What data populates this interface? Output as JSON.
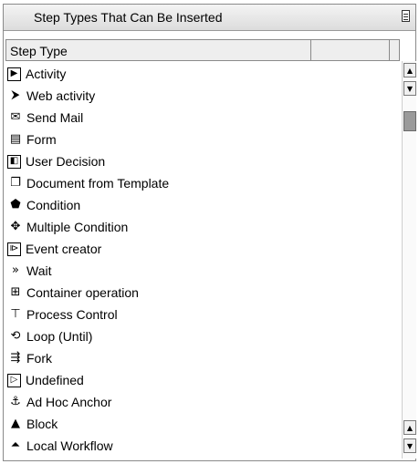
{
  "panel": {
    "title": "Step Types That Can Be Inserted"
  },
  "table": {
    "column_header": "Step Type",
    "rows": [
      {
        "label": "Activity",
        "icon": "activity-icon",
        "glyph": "▶"
      },
      {
        "label": "Web activity",
        "icon": "web-activity-icon",
        "glyph": "⮞"
      },
      {
        "label": "Send Mail",
        "icon": "send-mail-icon",
        "glyph": "✉"
      },
      {
        "label": "Form",
        "icon": "form-icon",
        "glyph": "▤"
      },
      {
        "label": "User Decision",
        "icon": "user-decision-icon",
        "glyph": "◧"
      },
      {
        "label": "Document from Template",
        "icon": "document-template-icon",
        "glyph": "❐"
      },
      {
        "label": "Condition",
        "icon": "condition-icon",
        "glyph": "⬟"
      },
      {
        "label": "Multiple Condition",
        "icon": "multiple-condition-icon",
        "glyph": "✥"
      },
      {
        "label": "Event creator",
        "icon": "event-creator-icon",
        "glyph": "⧐"
      },
      {
        "label": "Wait",
        "icon": "wait-icon",
        "glyph": "»"
      },
      {
        "label": "Container operation",
        "icon": "container-operation-icon",
        "glyph": "⊞"
      },
      {
        "label": "Process Control",
        "icon": "process-control-icon",
        "glyph": "⊤"
      },
      {
        "label": "Loop (Until)",
        "icon": "loop-icon",
        "glyph": "⟲"
      },
      {
        "label": "Fork",
        "icon": "fork-icon",
        "glyph": "⇶"
      },
      {
        "label": "Undefined",
        "icon": "undefined-icon",
        "glyph": "▷"
      },
      {
        "label": "Ad Hoc Anchor",
        "icon": "anchor-icon",
        "glyph": "⚓"
      },
      {
        "label": "Block",
        "icon": "block-icon",
        "glyph": "▲"
      },
      {
        "label": "Local Workflow",
        "icon": "local-workflow-icon",
        "glyph": "⏶"
      }
    ]
  },
  "scrollbar": {
    "up_glyph": "▲",
    "down_glyph": "▼"
  }
}
